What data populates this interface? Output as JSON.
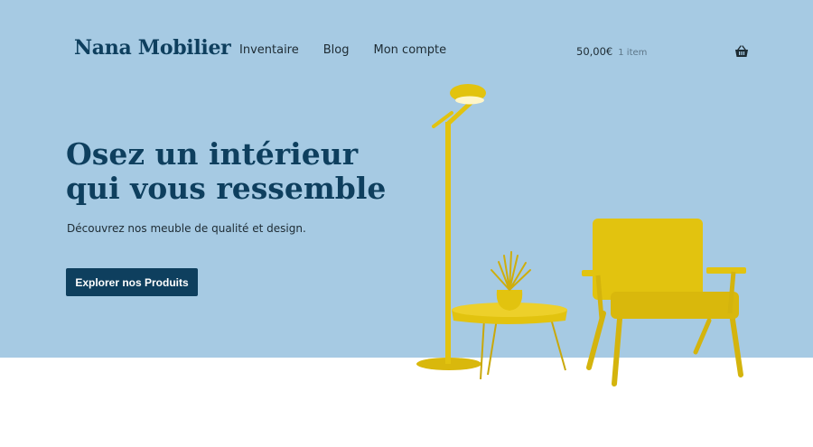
{
  "brand": {
    "name": "Nana Mobilier"
  },
  "nav": {
    "items": [
      {
        "label": "Inventaire"
      },
      {
        "label": "Blog"
      },
      {
        "label": "Mon compte"
      }
    ]
  },
  "cart": {
    "amount": "50,00€",
    "count": "1 item",
    "icon": "basket-icon"
  },
  "hero": {
    "title_line1": "Osez un intérieur",
    "title_line2": "qui vous ressemble",
    "subtitle": "Découvrez nos meuble de qualité et design.",
    "cta_label": "Explorer nos Produits"
  },
  "colors": {
    "hero_background": "#a6cae3",
    "brand_navy": "#0e3f5e",
    "furniture_yellow": "#e2c30f",
    "floor": "#ffffff"
  }
}
